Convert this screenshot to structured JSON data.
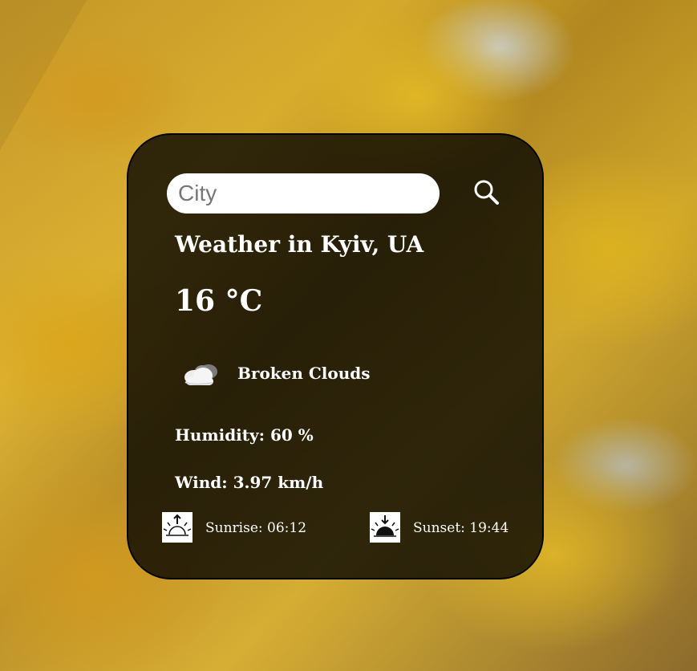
{
  "search": {
    "placeholder": "City",
    "value": ""
  },
  "weather": {
    "title": "Weather in Kyiv, UA",
    "temperature": "16 °C",
    "condition": "Broken Clouds",
    "humidity": "Humidity: 60 %",
    "wind": "Wind: 3.97 km/h",
    "sunrise": "Sunrise: 06:12",
    "sunset": "Sunset: 19:44"
  },
  "icons": {
    "search": "search-icon",
    "condition": "broken-clouds-icon",
    "sunrise": "sunrise-icon",
    "sunset": "sunset-icon"
  },
  "colors": {
    "card_background": "#000000",
    "text": "#ffffff",
    "search_background": "#ffffff",
    "search_placeholder": "#777777",
    "leaf_yellow": "#ddb02a",
    "sky_gray": "#d2d9dc"
  }
}
